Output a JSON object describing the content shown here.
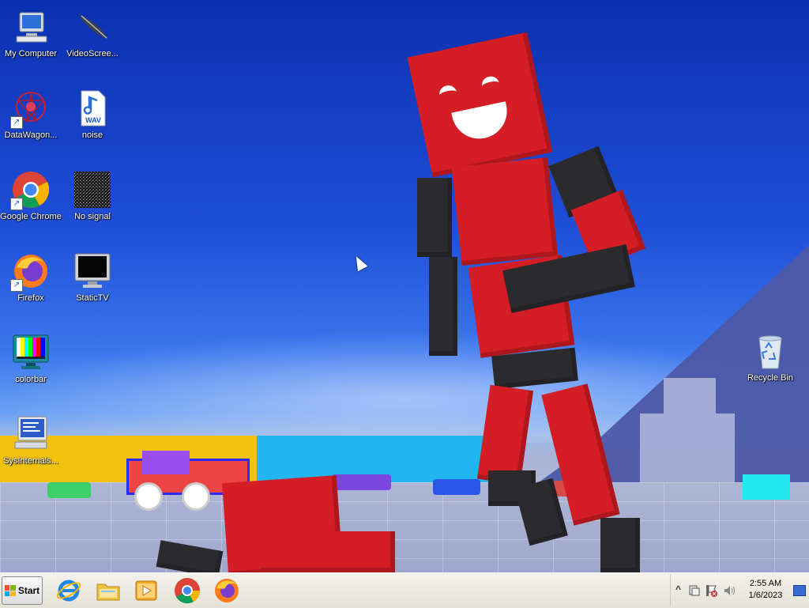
{
  "desktop": {
    "icons": [
      {
        "label": "My Computer",
        "icon": "computer-icon"
      },
      {
        "label": "VideoScree...",
        "icon": "quill-icon"
      },
      {
        "label": "DataWagon...",
        "icon": "datawagon-icon"
      },
      {
        "label": "noise",
        "icon": "wav-file-icon"
      },
      {
        "label": "Google Chrome",
        "icon": "chrome-icon"
      },
      {
        "label": "No signal",
        "icon": "noise-image-icon"
      },
      {
        "label": "Firefox",
        "icon": "firefox-icon"
      },
      {
        "label": "StaticTV",
        "icon": "monitor-icon"
      },
      {
        "label": "colorbar",
        "icon": "colorbar-icon"
      },
      {
        "label": "SysInternals...",
        "icon": "sysinternals-icon"
      },
      {
        "label": "Recycle Bin",
        "icon": "recycle-bin-icon"
      }
    ],
    "wav_badge": "WAV"
  },
  "taskbar": {
    "start_label": "Start",
    "pinned": [
      "internet-explorer-icon",
      "file-explorer-icon",
      "media-player-icon",
      "chrome-icon",
      "firefox-icon"
    ],
    "tray": {
      "overflow_glyph": "^",
      "time": "2:55 AM",
      "date": "1/6/2023"
    }
  },
  "colors": {
    "wallpaper_top": "#0b2fb0",
    "character_red": "#d41d24",
    "taskbar_bg": "#ece9e0"
  }
}
